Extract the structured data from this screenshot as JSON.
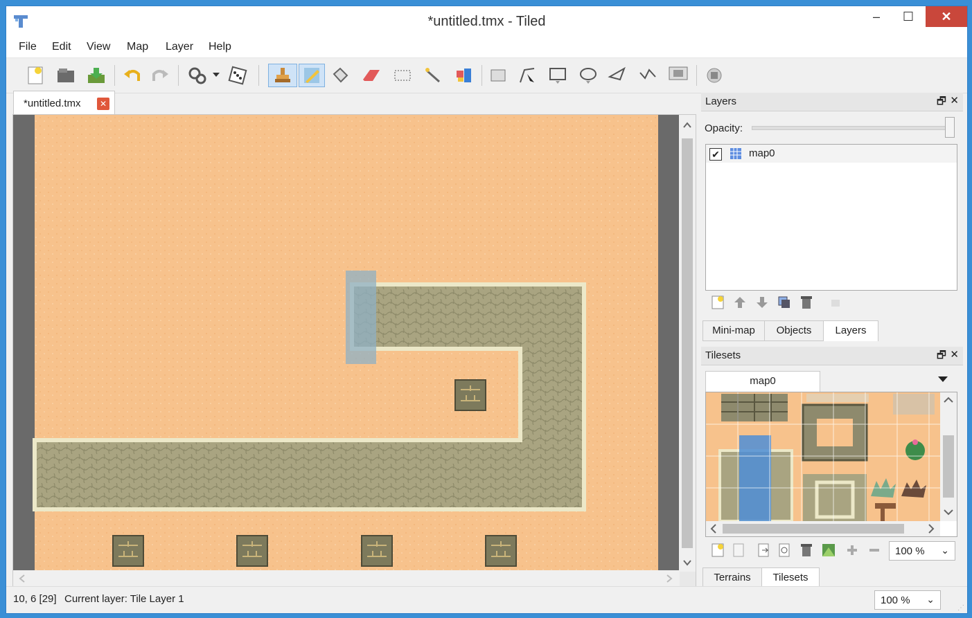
{
  "window": {
    "title": "*untitled.tmx - Tiled",
    "min_label": "–",
    "max_label": "☐",
    "close_label": "✕"
  },
  "menu": [
    "File",
    "Edit",
    "View",
    "Map",
    "Layer",
    "Help"
  ],
  "document_tab": {
    "label": "*untitled.tmx",
    "close_label": "✕"
  },
  "layers_panel": {
    "title": "Layers",
    "opacity_label": "Opacity:",
    "opacity_value": 1.0,
    "layers": [
      {
        "name": "map0",
        "visible": true
      }
    ],
    "tabs": [
      "Mini-map",
      "Objects",
      "Layers"
    ],
    "selected_tab": "Layers"
  },
  "tilesets_panel": {
    "title": "Tilesets",
    "tileset_tab": "map0",
    "zoom": "100 %",
    "tabs": [
      "Terrains",
      "Tilesets"
    ],
    "selected_tab": "Tilesets"
  },
  "status": {
    "coords": "10, 6 [29]",
    "current_layer": "Current layer: Tile Layer 1",
    "zoom": "100 %"
  },
  "icons": {
    "toolbar": [
      "new-map-icon",
      "open-icon",
      "save-icon",
      "undo-icon",
      "redo-icon",
      "random-mode-icon",
      "dice-icon",
      "stamp-brush-icon",
      "terrain-brush-icon",
      "bucket-fill-icon",
      "eraser-icon",
      "rect-select-icon",
      "magic-wand-icon",
      "select-same-tile-icon",
      "select-objects-icon",
      "edit-polygons-icon",
      "insert-rectangle-icon",
      "insert-ellipse-icon",
      "insert-polygon-icon",
      "insert-polyline-icon",
      "insert-tile-icon",
      "command-icon"
    ]
  },
  "colors": {
    "sand": "#f7c28c",
    "path": "#a9a481",
    "path_border": "#e9e5c6",
    "highlight": "#8fb0c4",
    "window_border": "#2f7fc7",
    "close_red": "#c9473b"
  }
}
